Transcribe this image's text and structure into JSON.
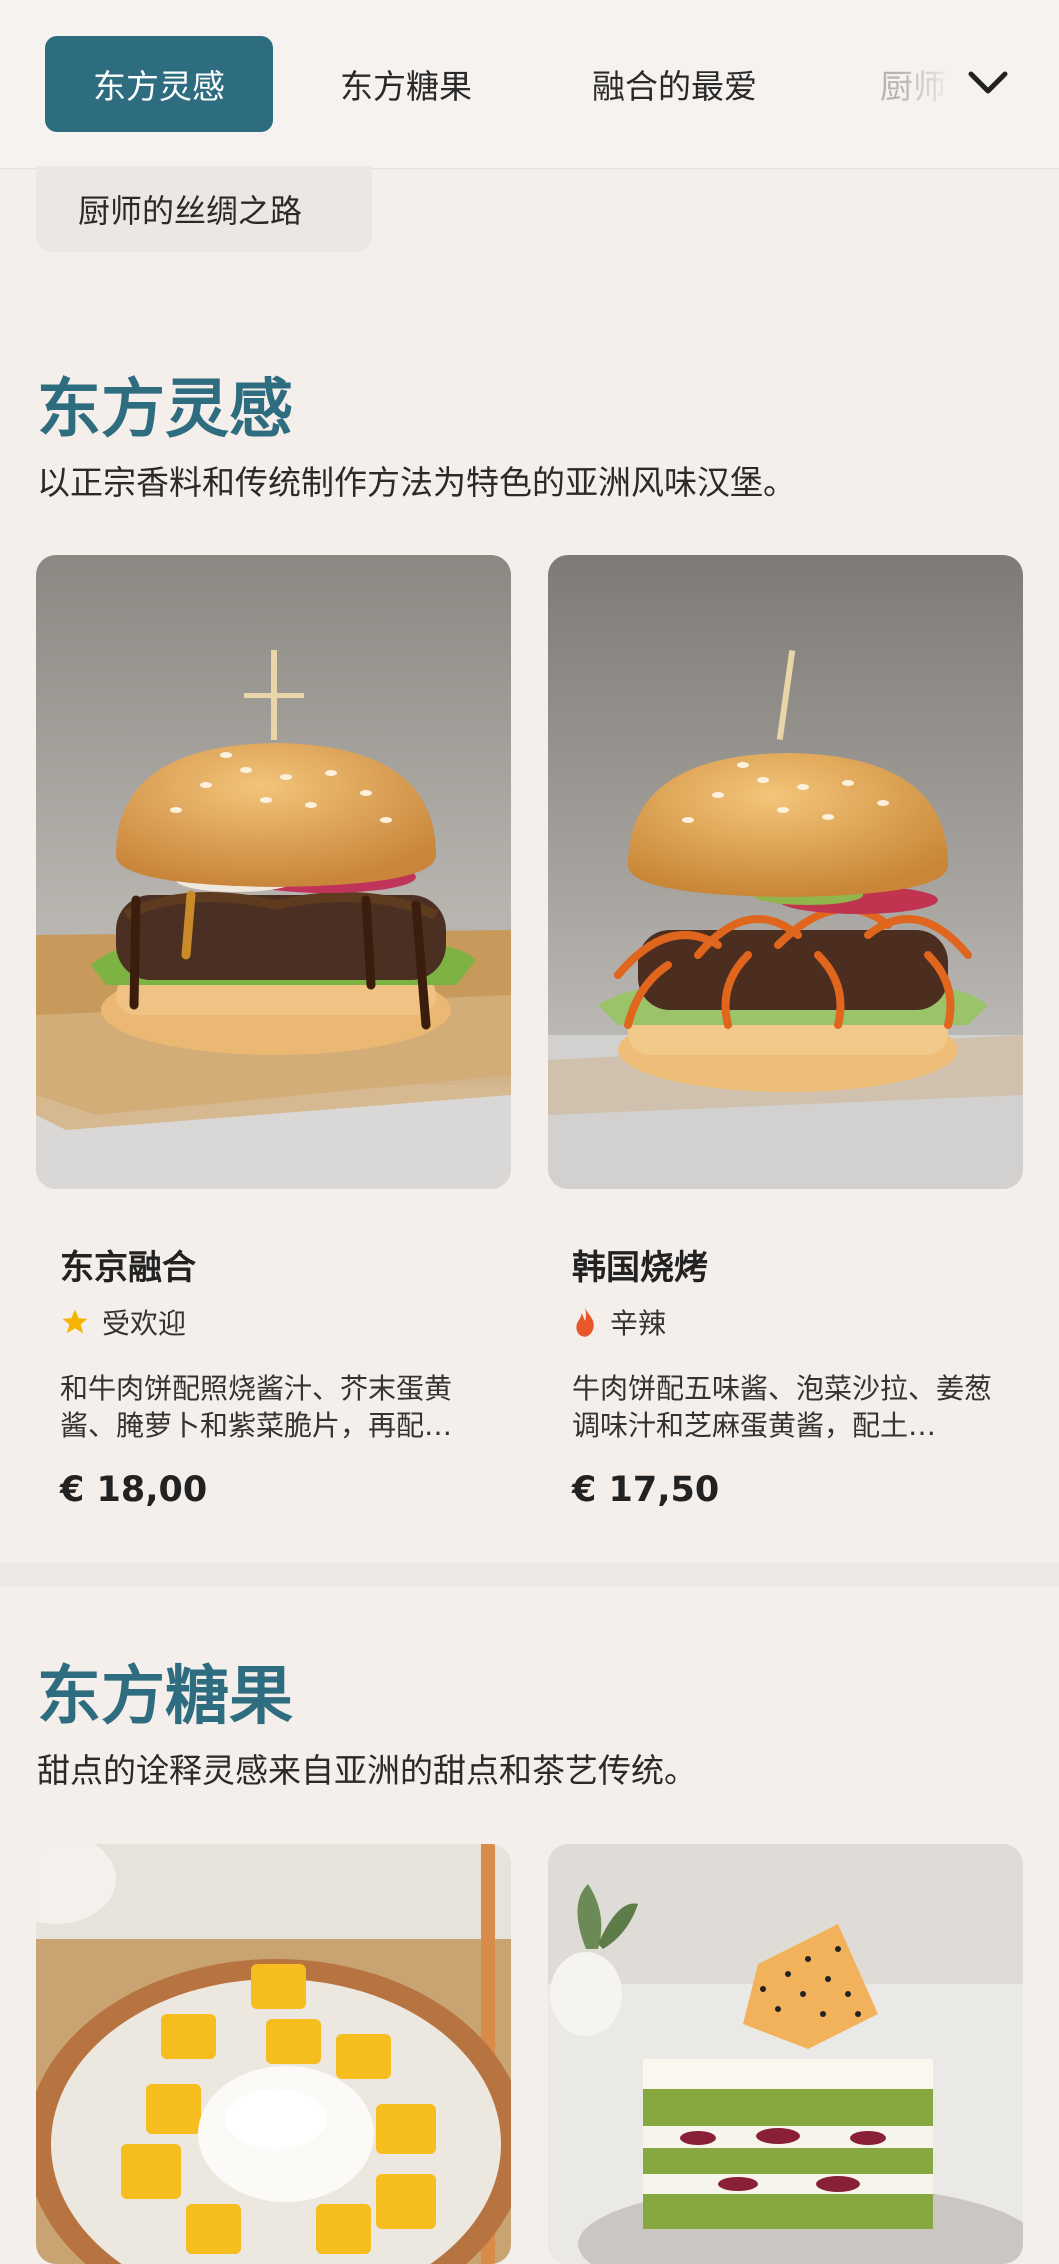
{
  "nav": {
    "tabs": [
      "东方灵感",
      "东方糖果",
      "融合的最爱",
      "厨师"
    ],
    "active_index": 0,
    "overflow_chip": "厨师的丝绸之路"
  },
  "sections": [
    {
      "title": "东方灵感",
      "description": "以正宗香料和传统制作方法为特色的亚洲风味汉堡。",
      "items": [
        {
          "name": "东京融合",
          "badge": "受欢迎",
          "badge_icon": "star-icon",
          "description": "和牛肉饼配照烧酱汁、芥末蛋黄酱、腌萝卜和紫菜脆片，再配…",
          "price": "€ 18,00"
        },
        {
          "name": "韩国烧烤",
          "badge": "辛辣",
          "badge_icon": "fire-icon",
          "description": "牛肉饼配五味酱、泡菜沙拉、姜葱调味汁和芝麻蛋黄酱，配土…",
          "price": "€ 17,50"
        }
      ]
    },
    {
      "title": "东方糖果",
      "description": "甜点的诠释灵感来自亚洲的甜点和茶艺传统。"
    }
  ],
  "colors": {
    "accent": "#2e6c7f",
    "background": "#f5efeb",
    "star": "#f4b400",
    "fire": "#e8562a"
  }
}
